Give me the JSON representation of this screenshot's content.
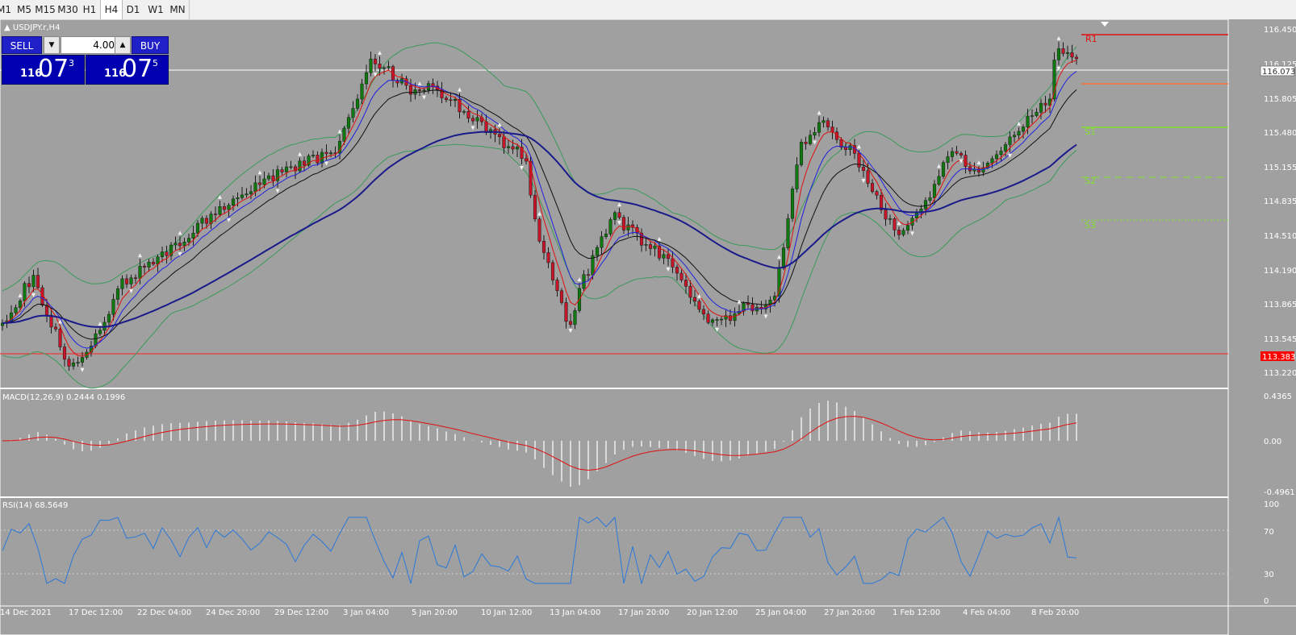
{
  "timeframes": [
    "M1",
    "M5",
    "M15",
    "M30",
    "H1",
    "H4",
    "D1",
    "W1",
    "MN"
  ],
  "active_timeframe": "H4",
  "symbol_label": "USDJPY.r,H4",
  "trade_panel": {
    "sell_label": "SELL",
    "buy_label": "BUY",
    "lot_value": "4.00",
    "sell_price": {
      "prefix": "116",
      "big": "07",
      "sup": "3"
    },
    "buy_price": {
      "prefix": "116",
      "big": "07",
      "sup": "5"
    }
  },
  "price_axis": {
    "ticks": [
      "116.450",
      "116.125",
      "115.805",
      "115.480",
      "115.155",
      "114.835",
      "114.510",
      "114.190",
      "113.865",
      "113.545",
      "113.220"
    ],
    "current_price": "116.073",
    "support_price": "113.383"
  },
  "pivot_labels": [
    "R1",
    "S1",
    "S2",
    "S3"
  ],
  "macd": {
    "label": "MACD(12,26,9) 0.2444 0.1996",
    "ticks": [
      "0.4365",
      "0.00",
      "-0.4961"
    ]
  },
  "rsi": {
    "label": "RSI(14) 68.5649",
    "ticks": [
      "100",
      "70",
      "30",
      "0"
    ]
  },
  "time_axis": [
    "14 Dec 2021",
    "17 Dec 12:00",
    "22 Dec 04:00",
    "24 Dec 20:00",
    "29 Dec 12:00",
    "3 Jan 04:00",
    "5 Jan 20:00",
    "10 Jan 12:00",
    "13 Jan 04:00",
    "17 Jan 20:00",
    "20 Jan 12:00",
    "25 Jan 04:00",
    "27 Jan 20:00",
    "1 Feb 12:00",
    "4 Feb 04:00",
    "8 Feb 20:00"
  ],
  "colors": {
    "bull_candle": "#0e7a0e",
    "bear_candle": "#c81428",
    "ma_fast": "#e01010",
    "ma_mid": "#2020e0",
    "ma_slow": "#101010",
    "ma_long": "#1a1a8a",
    "bollinger": "#3a9a5a",
    "macd_signal": "#e01010",
    "rsi_line": "#2a78d8",
    "r1": "#e01010",
    "pivot": "#ff7030",
    "s_levels": "#80e030"
  }
}
